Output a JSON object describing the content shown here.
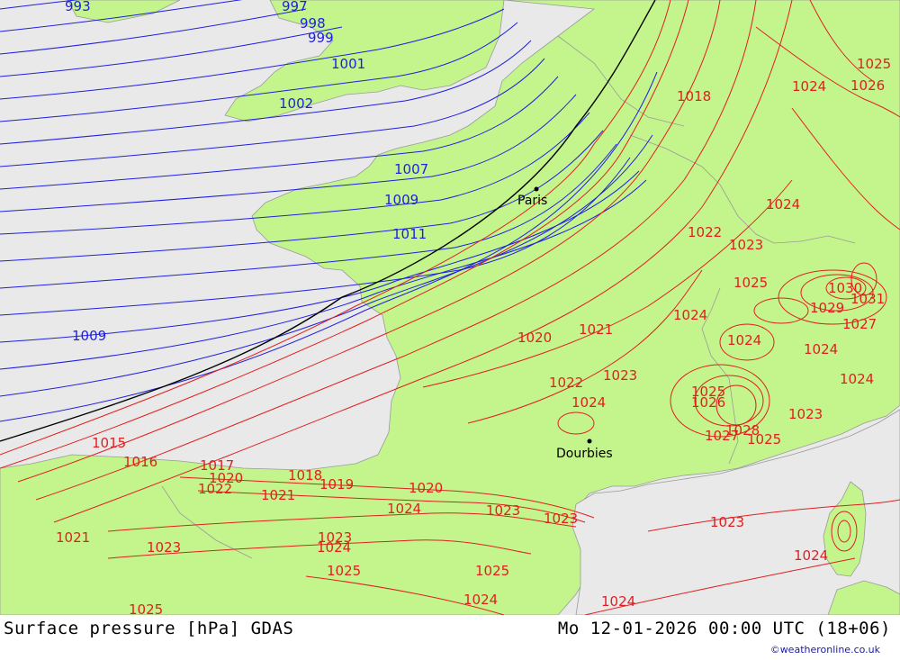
{
  "footer": {
    "title": "Surface pressure [hPa] GDAS",
    "timestamp": "Mo 12-01-2026 00:00 UTC (18+06)",
    "credit": "©weatheronline.co.uk"
  },
  "colors": {
    "sea": "#e9e9e9",
    "land": "#c4f58c",
    "isobar_low": "#1f1fe0",
    "isobar_high": "#e01f1f",
    "isobar_1013": "#000000"
  },
  "cities": [
    {
      "name": "Paris"
    },
    {
      "name": "Dourbies"
    }
  ],
  "labels_blue": [
    "993",
    "997",
    "998",
    "999",
    "1001",
    "1002",
    "1007",
    "1009",
    "1011",
    "1009"
  ],
  "labels_red": [
    "1018",
    "1024",
    "1025",
    "1026",
    "1024",
    "1022",
    "1023",
    "1025",
    "1030",
    "1031",
    "1029",
    "1027",
    "1024",
    "1024",
    "1024",
    "1020",
    "1021",
    "1022",
    "1023",
    "1024",
    "1025",
    "1026",
    "1028",
    "1027",
    "1025",
    "1023",
    "1024",
    "1015",
    "1016",
    "1017",
    "1018",
    "1020",
    "1022",
    "1021",
    "1019",
    "1020",
    "1024",
    "1023",
    "1023",
    "1021",
    "1023",
    "1023",
    "1024",
    "1025",
    "1025",
    "1025",
    "1024",
    "1024",
    "1023",
    "1024"
  ]
}
